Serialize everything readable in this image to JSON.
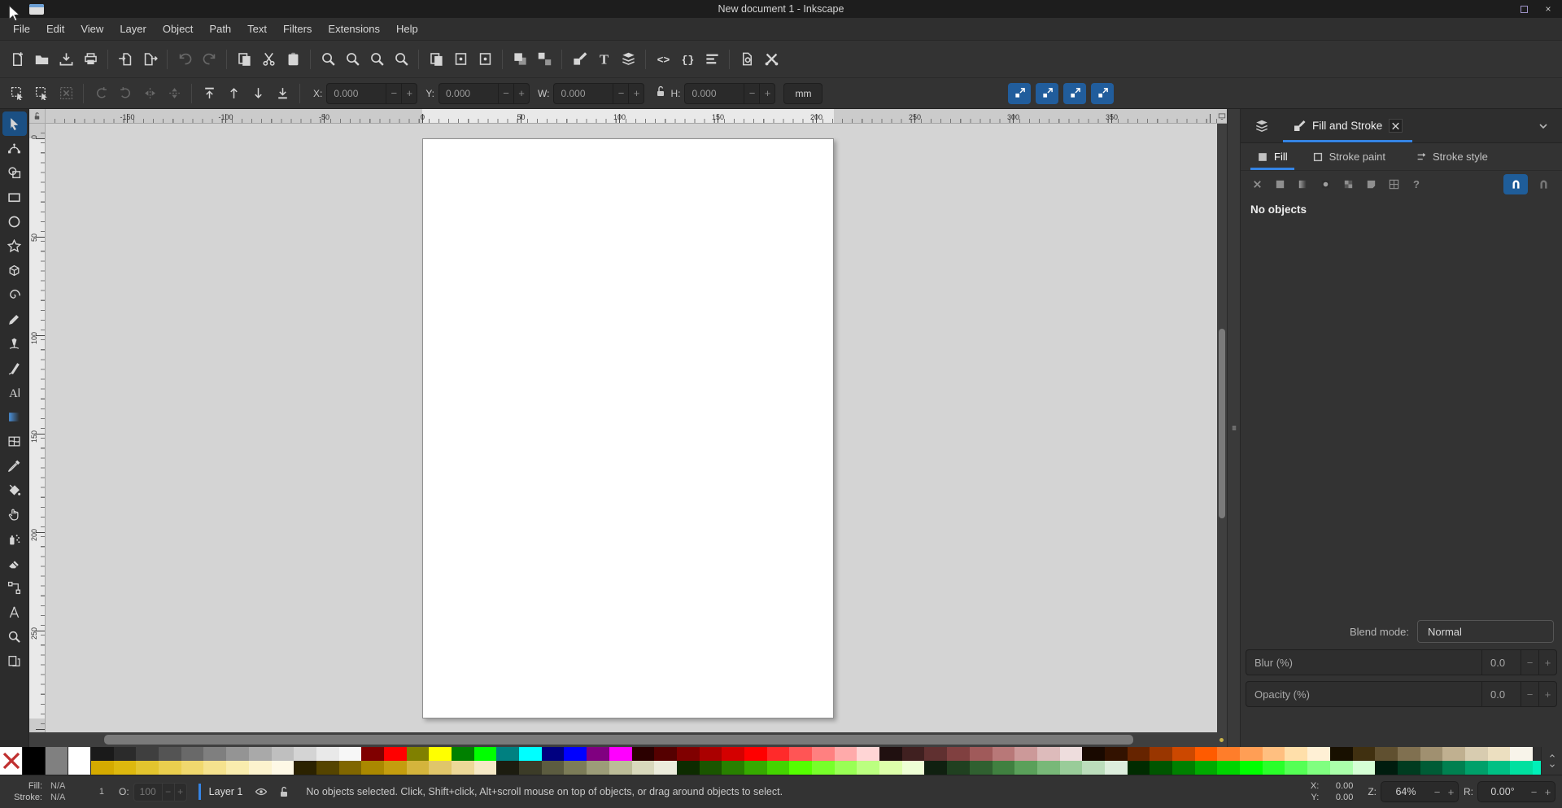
{
  "window": {
    "title": "New document 1 - Inkscape",
    "maximize_label": "maximize",
    "close_glyph": "×"
  },
  "menu": {
    "items": [
      {
        "label": "File",
        "name": "menu-file"
      },
      {
        "label": "Edit",
        "name": "menu-edit"
      },
      {
        "label": "View",
        "name": "menu-view"
      },
      {
        "label": "Layer",
        "name": "menu-layer"
      },
      {
        "label": "Object",
        "name": "menu-object"
      },
      {
        "label": "Path",
        "name": "menu-path"
      },
      {
        "label": "Text",
        "name": "menu-text"
      },
      {
        "label": "Filters",
        "name": "menu-filters"
      },
      {
        "label": "Extensions",
        "name": "menu-extensions"
      },
      {
        "label": "Help",
        "name": "menu-help"
      }
    ]
  },
  "command_bar": {
    "items": [
      {
        "name": "new-document-button",
        "icon": "s-docplus"
      },
      {
        "name": "open-document-button",
        "icon": "s-folder"
      },
      {
        "name": "save-document-button",
        "icon": "s-save"
      },
      {
        "name": "print-button",
        "icon": "s-print"
      },
      {
        "sep": 1
      },
      {
        "name": "import-button",
        "icon": "s-import"
      },
      {
        "name": "export-button",
        "icon": "s-export"
      },
      {
        "sep": 1
      },
      {
        "name": "undo-button",
        "icon": "s-undo",
        "disabled": 1
      },
      {
        "name": "redo-button",
        "icon": "s-redo",
        "disabled": 1
      },
      {
        "sep": 1
      },
      {
        "name": "copy-button",
        "icon": "s-copy"
      },
      {
        "name": "cut-button",
        "icon": "s-cut"
      },
      {
        "name": "paste-button",
        "icon": "s-paste"
      },
      {
        "sep": 1
      },
      {
        "name": "zoom-selection-button",
        "icon": "s-zoom"
      },
      {
        "name": "zoom-drawing-button",
        "icon": "s-zoom"
      },
      {
        "name": "zoom-page-button",
        "icon": "s-zoom"
      },
      {
        "name": "zoom-page-width-button",
        "icon": "s-zoom"
      },
      {
        "sep": 1
      },
      {
        "name": "duplicate-button",
        "icon": "s-copy"
      },
      {
        "name": "create-clone-button",
        "icon": "s-clone"
      },
      {
        "name": "unlink-clone-button",
        "icon": "s-clone"
      },
      {
        "sep": 1
      },
      {
        "name": "group-button",
        "icon": "s-group"
      },
      {
        "name": "ungroup-button",
        "icon": "s-ungroup"
      },
      {
        "sep": 1
      },
      {
        "name": "fill-stroke-dialog-button",
        "icon": "s-fillstroke"
      },
      {
        "name": "text-dialog-button",
        "icon": "s-text"
      },
      {
        "name": "layers-dialog-button",
        "icon": "s-layers"
      },
      {
        "sep": 1
      },
      {
        "name": "xml-editor-button",
        "icon": "s-xml"
      },
      {
        "name": "object-properties-button",
        "icon": "s-braces"
      },
      {
        "name": "align-distribute-button",
        "icon": "s-align"
      },
      {
        "sep": 1
      },
      {
        "name": "document-properties-button",
        "icon": "s-docgear"
      },
      {
        "name": "preferences-button",
        "icon": "s-prefs"
      }
    ]
  },
  "tool_controls": {
    "icons": [
      {
        "name": "select-all-button",
        "icon": "s-selall"
      },
      {
        "name": "select-all-layers-button",
        "icon": "s-selall"
      },
      {
        "name": "deselect-button",
        "icon": "s-deselect",
        "disabled": 1
      },
      {
        "sep": 1
      },
      {
        "name": "rotate-ccw-button",
        "icon": "s-rotccw",
        "disabled": 1
      },
      {
        "name": "rotate-cw-button",
        "icon": "s-rotcw",
        "disabled": 1
      },
      {
        "name": "flip-horizontal-button",
        "icon": "s-fliph",
        "disabled": 1
      },
      {
        "name": "flip-vertical-button",
        "icon": "s-flipv",
        "disabled": 1
      },
      {
        "sep": 1
      },
      {
        "name": "raise-to-top-button",
        "icon": "s-raisetop"
      },
      {
        "name": "raise-button",
        "icon": "s-raise"
      },
      {
        "name": "lower-button",
        "icon": "s-lower"
      },
      {
        "name": "lower-to-bottom-button",
        "icon": "s-lowerbottom"
      },
      {
        "sep": 1
      }
    ],
    "fields": {
      "x": {
        "label": "X:",
        "value": "0.000"
      },
      "y": {
        "label": "Y:",
        "value": "0.000"
      },
      "w": {
        "label": "W:",
        "value": "0.000"
      },
      "h": {
        "label": "H:",
        "value": "0.000"
      }
    },
    "unit": "mm",
    "spin_minus": "−",
    "spin_plus": "+",
    "toggles": [
      {
        "name": "scale-stroke-toggle",
        "icon": "s-scale"
      },
      {
        "name": "scale-corners-toggle",
        "icon": "s-scale"
      },
      {
        "name": "scale-gradients-toggle",
        "icon": "s-scale"
      },
      {
        "name": "scale-patterns-toggle",
        "icon": "s-scale"
      }
    ]
  },
  "toolbox": {
    "tools": [
      {
        "name": "selector-tool",
        "icon": "t-select",
        "active": 1
      },
      {
        "name": "node-tool",
        "icon": "t-node"
      },
      {
        "name": "shape-builder-tool",
        "icon": "t-shapebuilder"
      },
      {
        "name": "rectangle-tool",
        "icon": "t-rect"
      },
      {
        "name": "ellipse-tool",
        "icon": "t-ellipse"
      },
      {
        "name": "star-tool",
        "icon": "t-star"
      },
      {
        "name": "box-3d-tool",
        "icon": "t-box3d"
      },
      {
        "name": "spiral-tool",
        "icon": "t-spiral"
      },
      {
        "name": "pencil-tool",
        "icon": "t-pencil"
      },
      {
        "name": "pen-tool",
        "icon": "t-pen"
      },
      {
        "name": "calligraphy-tool",
        "icon": "t-calligraphy"
      },
      {
        "name": "text-tool",
        "icon": "t-text"
      },
      {
        "name": "gradient-tool",
        "icon": "t-gradient"
      },
      {
        "name": "mesh-gradient-tool",
        "icon": "t-mesh"
      },
      {
        "name": "dropper-tool",
        "icon": "t-dropper"
      },
      {
        "name": "paint-bucket-tool",
        "icon": "t-bucket"
      },
      {
        "name": "tweak-tool",
        "icon": "t-tweak"
      },
      {
        "name": "spray-tool",
        "icon": "t-spray"
      },
      {
        "name": "eraser-tool",
        "icon": "t-eraser"
      },
      {
        "name": "connector-tool",
        "icon": "t-connector"
      },
      {
        "name": "measure-tool",
        "icon": "t-measure"
      },
      {
        "name": "zoom-tool",
        "icon": "s-zoom"
      },
      {
        "name": "pages-tool",
        "icon": "t-pages"
      }
    ]
  },
  "canvas": {
    "h_ruler_labels": [
      "-150",
      "-100",
      "-50",
      "0",
      "50",
      "100",
      "150",
      "200",
      "250",
      "300",
      "350"
    ],
    "v_ruler_labels": [
      "0",
      "50",
      "100",
      "150",
      "200",
      "250"
    ]
  },
  "dock": {
    "panel_tab_label": "Fill and Stroke",
    "tabs": [
      {
        "label": "Fill",
        "icon": "s-fillsq",
        "active": 1
      },
      {
        "label": "Stroke paint",
        "icon": "s-strokesq"
      },
      {
        "label": "Stroke style",
        "icon": "s-strokestyle"
      }
    ],
    "paint_buttons": [
      {
        "name": "paint-none-button",
        "icon": "s-x"
      },
      {
        "name": "paint-flat-button",
        "icon": "s-flat"
      },
      {
        "name": "paint-linear-gradient-button",
        "icon": "s-lingrad"
      },
      {
        "name": "paint-radial-gradient-button",
        "icon": "s-radgrad"
      },
      {
        "name": "paint-pattern-button",
        "icon": "s-pattern"
      },
      {
        "name": "paint-swatch-button",
        "icon": "s-swatch"
      },
      {
        "name": "paint-mesh-button",
        "icon": "s-mesh"
      }
    ],
    "unknown_glyph": "?",
    "message": "No objects",
    "blend_label": "Blend mode:",
    "blend_value": "Normal",
    "blur_label": "Blur (%)",
    "blur_value": "0.0",
    "opacity_label": "Opacity (%)",
    "opacity_value": "0.0"
  },
  "palette": {
    "large_styles": [
      "background:#ffffff",
      "background:#000000",
      "background:#808080",
      "background:#ffffff"
    ],
    "row_top": [
      "#1a1a1a",
      "#2b2b2b",
      "#3f3f3f",
      "#545454",
      "#696969",
      "#7f7f7f",
      "#949494",
      "#a9a9a9",
      "#bfbfbf",
      "#d4d4d4",
      "#e9e9e9",
      "#f7f7f7",
      "#800000",
      "#ff0000",
      "#808000",
      "#ffff00",
      "#008000",
      "#00ff00",
      "#008080",
      "#00ffff",
      "#000080",
      "#0000ff",
      "#800080",
      "#ff00ff",
      "#2b0000",
      "#550000",
      "#800000",
      "#aa0000",
      "#d40000",
      "#ff0000",
      "#ff2a2a",
      "#ff5555",
      "#ff8080",
      "#ffaaaa",
      "#ffd5d5",
      "#201010",
      "#402020",
      "#603030",
      "#804040",
      "#a05a5a",
      "#b87878",
      "#cc9999",
      "#ddbbbb",
      "#eedddd",
      "#190900",
      "#331200",
      "#662400",
      "#993600",
      "#cc4800",
      "#ff5b00",
      "#ff7d2a",
      "#ff9e55",
      "#ffbf80",
      "#ffdfaa",
      "#fff0d5",
      "#181000",
      "#403010",
      "#605030",
      "#807050",
      "#a09070",
      "#c0b090",
      "#d8ccb0",
      "#ecdfc0",
      "#f8f4ea"
    ],
    "row_bottom": [
      "#d4aa00",
      "#ddb80e",
      "#e3c42e",
      "#eace4e",
      "#f0d86e",
      "#f5e28e",
      "#f9ecae",
      "#fcf3ce",
      "#fef9e6",
      "#2b2200",
      "#554400",
      "#806600",
      "#aa8800",
      "#c49d0e",
      "#d4b43c",
      "#e0c66a",
      "#ecd898",
      "#f5e9c6",
      "#1c1c10",
      "#3c3c28",
      "#5c5c40",
      "#7c7c58",
      "#9c9c78",
      "#bcbc98",
      "#d8d8bc",
      "#ececdc",
      "#0d2b00",
      "#1a5500",
      "#288000",
      "#36aa00",
      "#44d400",
      "#55ff00",
      "#77ff2a",
      "#99ff55",
      "#bbff80",
      "#ddffaa",
      "#eeffd5",
      "#102010",
      "#204020",
      "#306030",
      "#408040",
      "#5aa05a",
      "#78b878",
      "#99cc99",
      "#bbddbb",
      "#ddeedd",
      "#002b00",
      "#005500",
      "#008000",
      "#00aa00",
      "#00d400",
      "#00ff00",
      "#2aff2a",
      "#55ff55",
      "#80ff80",
      "#aaffaa",
      "#d5ffd5",
      "#001c0e",
      "#003c20",
      "#005c36",
      "#008050",
      "#00a06a",
      "#00c084",
      "#00e0a0",
      "#00f0b8"
    ]
  },
  "status_bar": {
    "fill_label": "Fill:",
    "fill_value": "N/A",
    "stroke_label": "Stroke:",
    "stroke_value": "N/A",
    "stroke_width": "1",
    "opacity_label": "O:",
    "opacity_value": "100",
    "layer_label": "Layer 1",
    "message": "No objects selected. Click, Shift+click, Alt+scroll mouse on top of objects, or drag around objects to select.",
    "x_label": "X:",
    "x_value": "0.00",
    "y_label": "Y:",
    "y_value": "0.00",
    "zoom_label": "Z:",
    "zoom_value": "64%",
    "rotation_label": "R:",
    "rotation_value": "0.00°"
  },
  "colors": {
    "accent": "#3584e4",
    "toggle_blue": "#215d9c",
    "canvas_bg": "#d4d4d4",
    "page": "#ffffff"
  }
}
